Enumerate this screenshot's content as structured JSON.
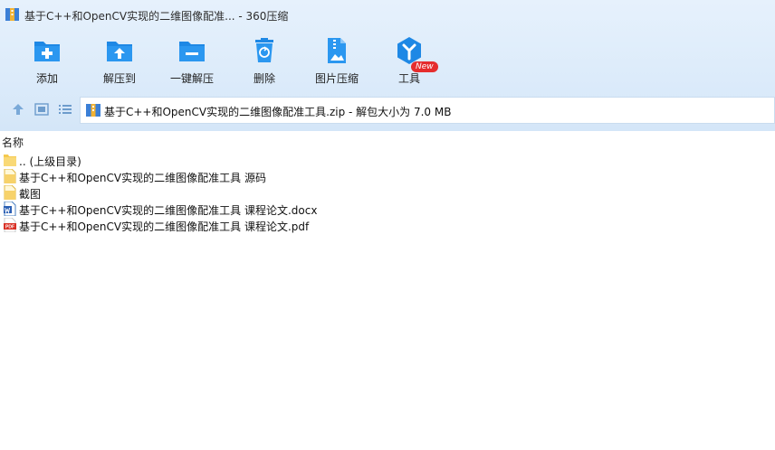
{
  "window": {
    "title": "基于C++和OpenCV实现的二维图像配准... - 360压缩"
  },
  "toolbar": {
    "items": [
      {
        "label": "添加",
        "icon": "add-folder-icon"
      },
      {
        "label": "解压到",
        "icon": "extract-to-icon"
      },
      {
        "label": "一键解压",
        "icon": "one-click-extract-icon"
      },
      {
        "label": "删除",
        "icon": "trash-icon"
      },
      {
        "label": "图片压缩",
        "icon": "image-compress-icon"
      },
      {
        "label": "工具",
        "icon": "tools-icon"
      }
    ],
    "badge": "New"
  },
  "nav": {
    "address": "基于C++和OpenCV实现的二维图像配准工具.zip - 解包大小为 7.0 MB"
  },
  "list": {
    "column_name": "名称",
    "rows": [
      {
        "name": ".. (上级目录)",
        "type": "folder"
      },
      {
        "name": "基于C++和OpenCV实现的二维图像配准工具 源码",
        "type": "folder-doc"
      },
      {
        "name": "截图",
        "type": "folder-doc"
      },
      {
        "name": "基于C++和OpenCV实现的二维图像配准工具 课程论文.docx",
        "type": "docx"
      },
      {
        "name": "基于C++和OpenCV实现的二维图像配准工具 课程论文.pdf",
        "type": "pdf"
      }
    ]
  },
  "colors": {
    "accent": "#1e88e5",
    "toolbar_bg": "#dcebfa",
    "pdf_red": "#d93025",
    "folder_yellow": "#f7d26a"
  }
}
